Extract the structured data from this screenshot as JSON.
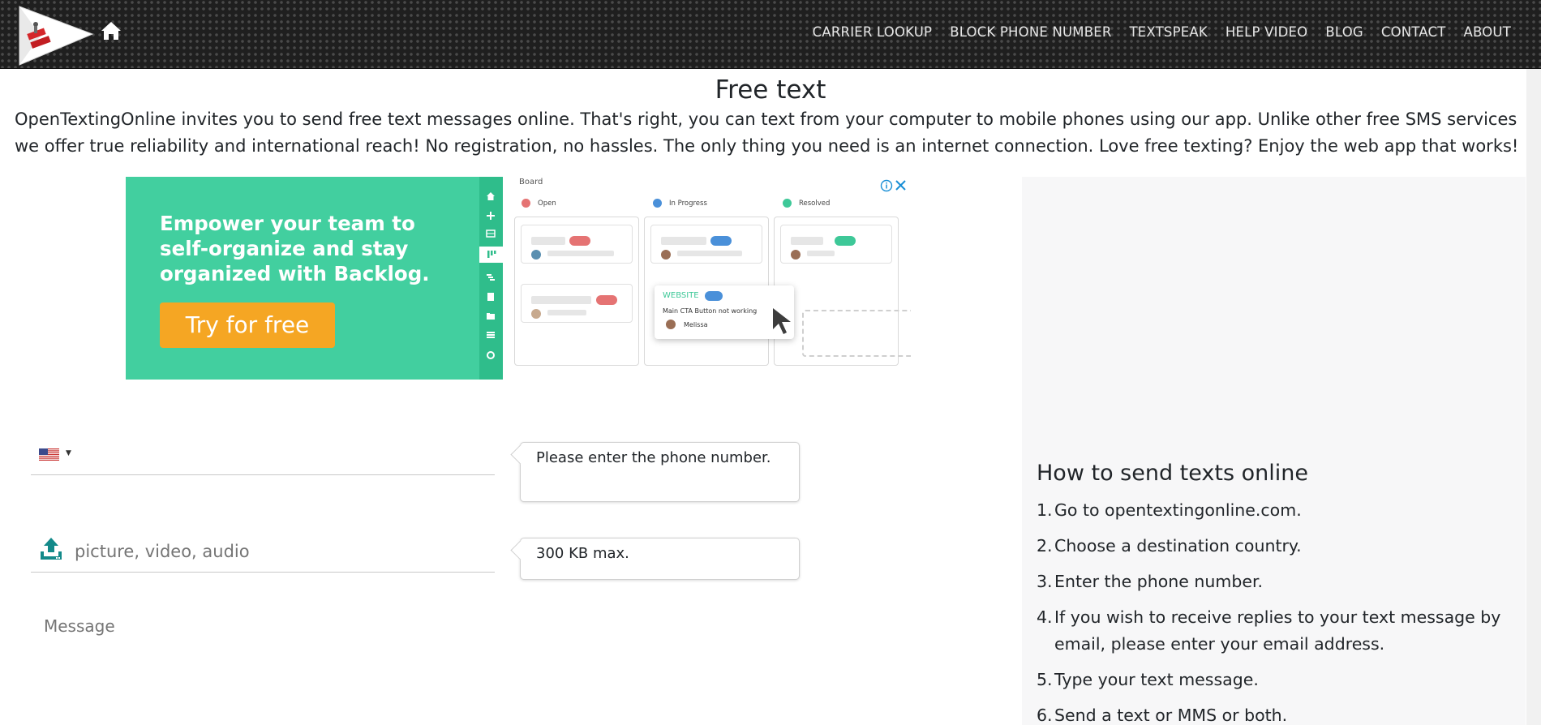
{
  "header": {
    "logo_alt": "OpenTextingOnline logo",
    "nav": [
      "CARRIER LOOKUP",
      "BLOCK PHONE NUMBER",
      "TEXTSPEAK",
      "HELP VIDEO",
      "BLOG",
      "CONTACT",
      "ABOUT"
    ]
  },
  "main": {
    "title": "Free text",
    "intro": "OpenTextingOnline invites you to send free text messages online. That's right, you can text from your computer to mobile phones using our app. Unlike other free SMS services we offer true reliability and international reach! No registration, no hassles. The only thing you need is an internet connection. Love free texting? Enjoy the web app that works!"
  },
  "ad": {
    "headline": "Empower your team to self-organize and stay organized with Backlog.",
    "cta": "Try for free",
    "board_label": "Board",
    "columns": [
      "Open",
      "In Progress",
      "Resolved"
    ],
    "column_colors": [
      "#e57373",
      "#4a90d9",
      "#3ec898"
    ],
    "popup_tag": "WEBSITE",
    "popup_desc": "Main CTA Button not working",
    "popup_user": "Melissa",
    "brand_color": "#42cf9f",
    "cta_color": "#f5a623"
  },
  "form": {
    "phone_value": "",
    "phone_tip": "Please enter the phone number.",
    "file_placeholder": "picture, video, audio",
    "file_tip": "300 KB max.",
    "message_placeholder": "Message",
    "icon_color": "#138a8a"
  },
  "howto": {
    "title": "How to send texts online",
    "steps": [
      {
        "num": "1.",
        "text": "Go to opentextingonline.com."
      },
      {
        "num": "2.",
        "text": "Choose a destination country."
      },
      {
        "num": "3.",
        "text": "Enter the phone number."
      },
      {
        "num": "4.",
        "text": "If you wish to receive replies to your text message by email, please enter your email address."
      },
      {
        "num": "5.",
        "text": "Type your text message."
      },
      {
        "num": "6.",
        "text": "Send a text or MMS or both."
      }
    ]
  }
}
